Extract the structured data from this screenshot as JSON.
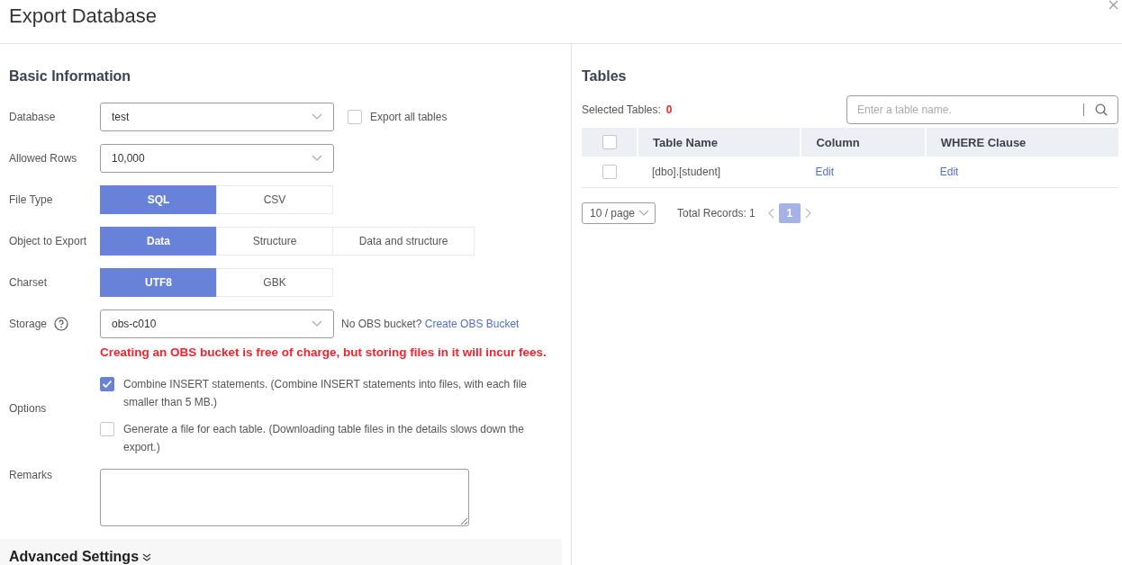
{
  "dialog": {
    "title": "Export Database"
  },
  "basic_information": {
    "heading": "Basic Information",
    "database": {
      "label": "Database",
      "value": "test",
      "export_all": {
        "label": "Export all tables",
        "checked": false
      }
    },
    "allowed_rows": {
      "label": "Allowed Rows",
      "value": "10,000"
    },
    "segments": [
      {
        "label": "File Type",
        "options": [
          {
            "label": "SQL",
            "selected": true
          },
          {
            "label": "CSV",
            "selected": false
          }
        ]
      },
      {
        "label": "Object to Export",
        "options": [
          {
            "label": "Data",
            "selected": true
          },
          {
            "label": "Structure",
            "selected": false
          },
          {
            "label": "Data and structure",
            "selected": false
          }
        ]
      },
      {
        "label": "Charset",
        "options": [
          {
            "label": "UTF8",
            "selected": true
          },
          {
            "label": "GBK",
            "selected": false
          }
        ]
      }
    ],
    "storage": {
      "label": "Storage",
      "value": "obs-c010",
      "hint": "No OBS bucket?",
      "link": "Create OBS Bucket",
      "warning": "Creating an OBS bucket is free of charge, but storing files in it will incur fees."
    },
    "options": {
      "label": "Options",
      "items": [
        {
          "label": "Combine INSERT statements. (Combine INSERT statements into files, with each file smaller than 5 MB.)",
          "checked": true
        },
        {
          "label": "Generate a file for each table. (Downloading table files in the details slows down the export.)",
          "checked": false
        }
      ]
    },
    "remarks": {
      "label": "Remarks"
    }
  },
  "advanced_settings": {
    "label": "Advanced Settings",
    "expanded": false
  },
  "tables": {
    "heading": "Tables",
    "selected_label": "Selected Tables:",
    "selected_count": "0",
    "search": {
      "placeholder": "Enter a table name."
    },
    "header_checked": false,
    "columns": [
      "Table Name",
      "Column",
      "WHERE Clause"
    ],
    "rows": [
      {
        "checked": false,
        "table_name": "[dbo].[student]",
        "column": "Edit",
        "where_clause": "Edit"
      }
    ],
    "pagination": {
      "page_size": "10 / page",
      "total": "Total Records: 1",
      "pages": [
        {
          "label": "1",
          "selected": true
        }
      ]
    }
  }
}
